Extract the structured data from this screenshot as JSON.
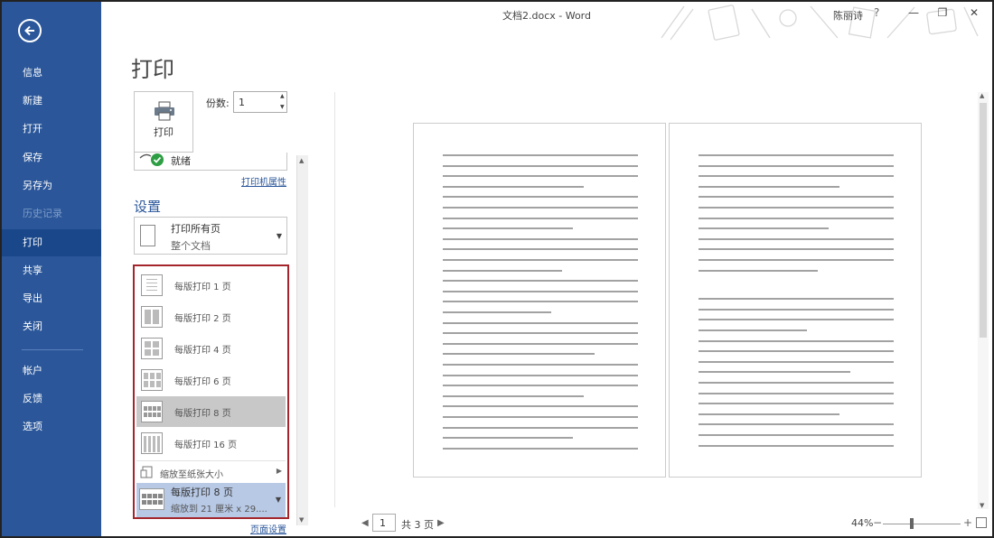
{
  "window": {
    "title": "文档2.docx - Word",
    "user": "陈丽诗",
    "help": "?",
    "minimize": "—",
    "restore": "❐",
    "close": "✕"
  },
  "nav": {
    "items": [
      {
        "label": "信息"
      },
      {
        "label": "新建"
      },
      {
        "label": "打开"
      },
      {
        "label": "保存"
      },
      {
        "label": "另存为"
      },
      {
        "label": "历史记录"
      },
      {
        "label": "打印"
      },
      {
        "label": "共享"
      },
      {
        "label": "导出"
      },
      {
        "label": "关闭"
      },
      {
        "label": "帐户"
      },
      {
        "label": "反馈"
      },
      {
        "label": "选项"
      }
    ]
  },
  "print": {
    "title": "打印",
    "button_label": "打印",
    "copies_label": "份数:",
    "copies_value": "1",
    "printer_status": "就绪",
    "printer_properties": "打印机属性",
    "settings_title": "设置",
    "pages_main": "打印所有页",
    "pages_sub": "整个文档",
    "menu": [
      {
        "label": "每版打印 1 页"
      },
      {
        "label": "每版打印 2 页"
      },
      {
        "label": "每版打印 4 页"
      },
      {
        "label": "每版打印 6 页"
      },
      {
        "label": "每版打印 8 页"
      },
      {
        "label": "每版打印 16 页"
      }
    ],
    "scale_to_paper": "缩放至纸张大小",
    "pages_per_sheet_main": "每版打印 8 页",
    "pages_per_sheet_sub": "缩放到 21 厘米 x 29....",
    "page_setup": "页面设置"
  },
  "preview": {
    "page_current": "1",
    "page_total": "共 3 页",
    "zoom": "44%"
  }
}
